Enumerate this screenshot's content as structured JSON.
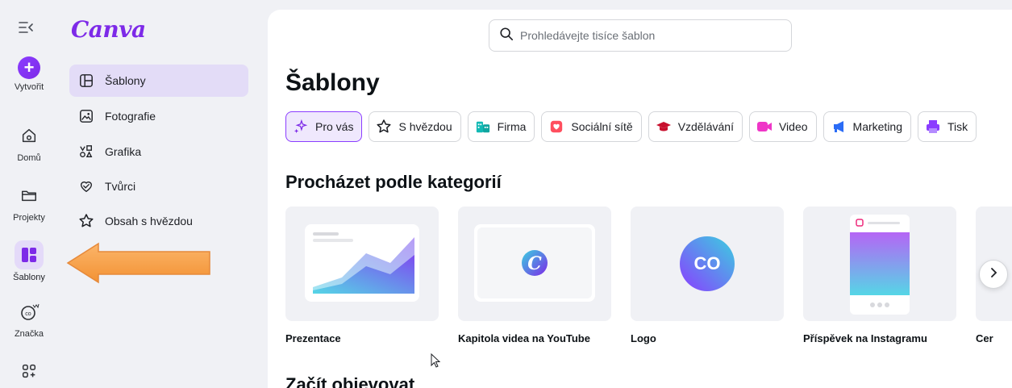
{
  "rail": {
    "create_label": "Vytvořit",
    "items": [
      {
        "label": "Domů",
        "icon": "home-icon"
      },
      {
        "label": "Projekty",
        "icon": "folder-icon"
      },
      {
        "label": "Šablony",
        "icon": "templates-icon"
      },
      {
        "label": "Značka",
        "icon": "brand-icon"
      },
      {
        "label": "",
        "icon": "apps-icon"
      }
    ]
  },
  "sidebar": {
    "logo": "Canva",
    "items": [
      {
        "label": "Šablony",
        "icon": "templates-icon"
      },
      {
        "label": "Fotografie",
        "icon": "photo-icon"
      },
      {
        "label": "Grafika",
        "icon": "graphics-icon"
      },
      {
        "label": "Tvůrci",
        "icon": "creators-icon"
      },
      {
        "label": "Obsah s hvězdou",
        "icon": "star-icon"
      }
    ]
  },
  "search": {
    "placeholder": "Prohledávejte tisíce šablon"
  },
  "main": {
    "title": "Šablony",
    "chips": [
      {
        "label": "Pro vás",
        "icon": "sparkle-icon"
      },
      {
        "label": "S hvězdou",
        "icon": "star-icon"
      },
      {
        "label": "Firma",
        "icon": "business-icon"
      },
      {
        "label": "Sociální sítě",
        "icon": "social-icon"
      },
      {
        "label": "Vzdělávání",
        "icon": "graduation-cap-icon"
      },
      {
        "label": "Video",
        "icon": "video-icon"
      },
      {
        "label": "Marketing",
        "icon": "megaphone-icon"
      },
      {
        "label": "Tisk",
        "icon": "print-icon"
      }
    ],
    "categories_title": "Procházet podle kategorií",
    "cards": [
      {
        "label": "Prezentace"
      },
      {
        "label": "Kapitola videa na YouTube"
      },
      {
        "label": "Logo"
      },
      {
        "label": "Příspěvek na Instagramu"
      },
      {
        "label": "Cer"
      }
    ],
    "logo_thumb_text": "CO",
    "discover_title": "Začít objevovat"
  },
  "colors": {
    "accent": "#8b3dff",
    "active_bg": "#e3dcf7",
    "arrow": "#f7a14a"
  }
}
